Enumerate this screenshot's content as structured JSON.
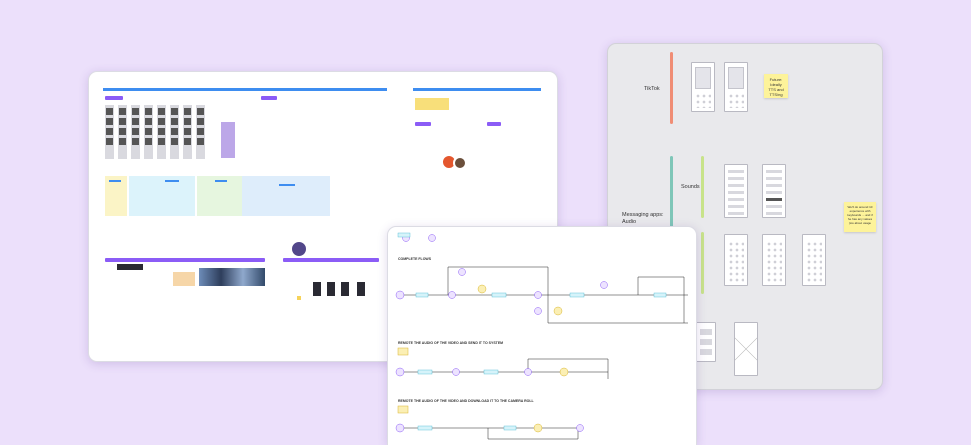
{
  "right_board": {
    "sections": [
      {
        "label": "TikTok",
        "color": "#f08d75"
      },
      {
        "label": "Sounds",
        "color": "#c8e38a"
      },
      {
        "label": "Messaging apps: Audio",
        "color": "#7fc6b8"
      }
    ],
    "stickies": [
      "Future: Ideally TTS and TTS/ng",
      "We’ll do around 10 experience with keyboards ... and if he has any values (ios about usage"
    ]
  },
  "left_board": {
    "accent_blue": "#3e8df0",
    "accent_purple": "#8b5cf6"
  },
  "flow_board": {
    "sections": [
      "COMPLETE FLOWS",
      "REMOTE THE AUDIO OF THE VIDEO AND SEND IT TO SYSTEM",
      "REMOTE THE AUDIO OF THE VIDEO AND DOWNLOAD IT TO THE CAMERA ROLL"
    ]
  }
}
